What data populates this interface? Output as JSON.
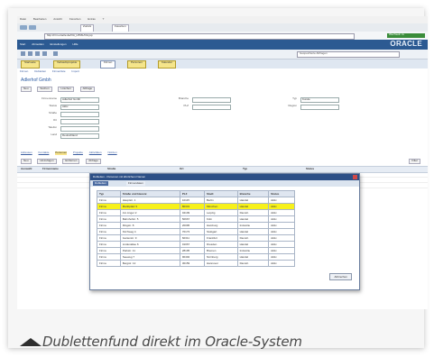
{
  "browser": {
    "menu": [
      "Datei",
      "Bearbeiten",
      "Ansicht",
      "Favoriten",
      "Extras",
      "?"
    ],
    "back_label": "Zurück",
    "tab_label": "Favoriten",
    "address": "http://crm.oracle.de/OA_HTML/OA.jsp",
    "go_label": "Wechseln zu"
  },
  "oracle": {
    "logo": "ORACLE",
    "menu": [
      "Start",
      "Abmelden",
      "Einstellungen",
      "Hilfe"
    ],
    "search_placeholder": "Gespeicherte Abfragen"
  },
  "app_tabs": [
    "Startseite",
    "Verkaufsprojekte",
    "Firmen",
    "Personen",
    "Kalender"
  ],
  "subnav": [
    "Firmen",
    "Dubletten",
    "Firmenliste",
    "Import"
  ],
  "section": {
    "title": "Adlerhof Gmbh",
    "actions": [
      "Neu",
      "Suchen",
      "Löschen",
      "Abfrage"
    ]
  },
  "form": {
    "fields": [
      {
        "label": "Firmenname",
        "value": "Adlerhof Gmbh"
      },
      {
        "label": "Status",
        "value": "Aktiv"
      },
      {
        "label": "Straße",
        "value": ""
      },
      {
        "label": "Ort",
        "value": ""
      },
      {
        "label": "Telefon",
        "value": ""
      },
      {
        "label": "Land",
        "value": "Deutschland"
      }
    ],
    "right_fields": [
      {
        "label": "Branche",
        "value": ""
      },
      {
        "label": "PLZ",
        "value": ""
      },
      {
        "label": "Typ",
        "value": "Kunde"
      },
      {
        "label": "Region",
        "value": ""
      }
    ]
  },
  "links": [
    "Adressen",
    "Kontakte",
    "Personen",
    "Projekte",
    "Aktivitäten",
    "Notizen"
  ],
  "table_actions": {
    "buttons": [
      "Neu",
      "Hinzufügen",
      "Entfernen",
      "Abfrage"
    ],
    "right": "Filter"
  },
  "table_headers": [
    "Auswahl",
    "Firmenname",
    "Straße",
    "Ort",
    "Typ",
    "Status"
  ],
  "dialog": {
    "title": "Dubletten - Personen mit ähnlichem Namen",
    "tabs": [
      "Dubletten",
      "Firmendaten"
    ],
    "headers": [
      "Typ",
      "Straße und Hausnr.",
      "PLZ",
      "Stadt",
      "Branche",
      "Status"
    ],
    "rows": [
      {
        "c": [
          "Firma",
          "Hauptstr. 1",
          "10115",
          "Berlin",
          "Handel",
          "Aktiv"
        ],
        "hl": false
      },
      {
        "c": [
          "Firma",
          "Marktplatz 3",
          "80331",
          "München",
          "Handel",
          "Aktiv"
        ],
        "hl": true
      },
      {
        "c": [
          "Firma",
          "Am Anger 2",
          "04109",
          "Leipzig",
          "Dienstl.",
          "Aktiv"
        ],
        "hl": false
      },
      {
        "c": [
          "Firma",
          "Bahnhofstr. 5",
          "50667",
          "Köln",
          "Handel",
          "Aktiv"
        ],
        "hl": false
      },
      {
        "c": [
          "Firma",
          "Ringstr. 8",
          "20095",
          "Hamburg",
          "Industrie",
          "Aktiv"
        ],
        "hl": false
      },
      {
        "c": [
          "Firma",
          "Kirchweg 4",
          "70173",
          "Stuttgart",
          "Handel",
          "Aktiv"
        ],
        "hl": false
      },
      {
        "c": [
          "Firma",
          "Gartenstr. 9",
          "60311",
          "Frankfurt",
          "Dienstl.",
          "Aktiv"
        ],
        "hl": false
      },
      {
        "c": [
          "Firma",
          "Lindenallee 6",
          "01067",
          "Dresden",
          "Handel",
          "Aktiv"
        ],
        "hl": false
      },
      {
        "c": [
          "Firma",
          "Parkstr. 11",
          "28195",
          "Bremen",
          "Industrie",
          "Aktiv"
        ],
        "hl": false
      },
      {
        "c": [
          "Firma",
          "Seeweg 7",
          "90402",
          "Nürnberg",
          "Handel",
          "Aktiv"
        ],
        "hl": false
      },
      {
        "c": [
          "Firma",
          "Bergstr. 12",
          "30159",
          "Hannover",
          "Dienstl.",
          "Aktiv"
        ],
        "hl": false
      }
    ],
    "ok_label": "Abbrechen"
  },
  "caption": "Dublettenfund direkt im Oracle-System"
}
